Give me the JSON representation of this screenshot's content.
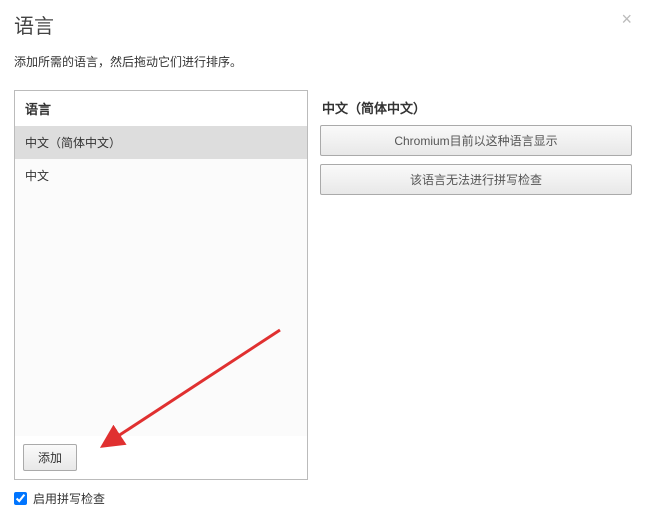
{
  "header": {
    "title": "语言",
    "description": "添加所需的语言，然后拖动它们进行排序。"
  },
  "left": {
    "header": "语言",
    "items": [
      {
        "label": "中文（简体中文）",
        "selected": true
      },
      {
        "label": "中文",
        "selected": false
      }
    ],
    "add_label": "添加"
  },
  "right": {
    "header": "中文（简体中文）",
    "display_status": "Chromium目前以这种语言显示",
    "spellcheck_status": "该语言无法进行拼写检查"
  },
  "footer": {
    "checkbox_checked": true,
    "label": "启用拼写检查"
  }
}
